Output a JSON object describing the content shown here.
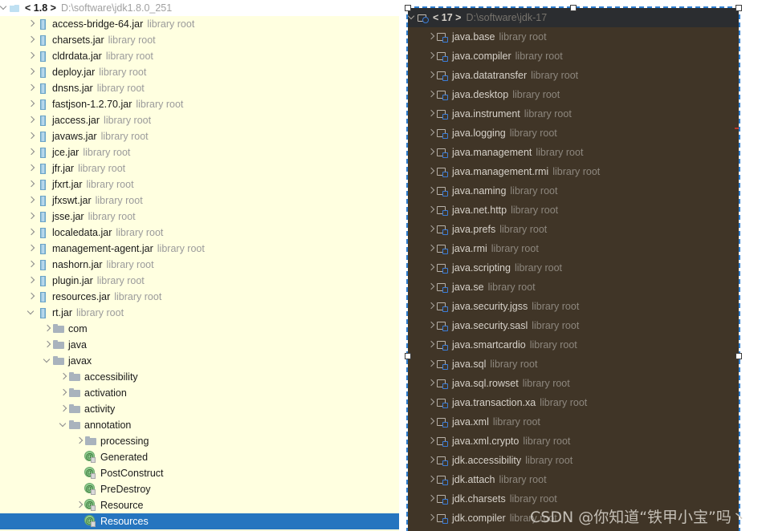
{
  "left_panel": {
    "name": "jdk-1.8-library-tree",
    "background_color": "#ffffe0",
    "selection_color": "#2675bf",
    "root": {
      "version": "1.8",
      "version_display": "< 1.8 >",
      "path": "D:\\software\\jdk1.8.0_251",
      "expanded": true
    },
    "sub_label": "library root",
    "items": [
      {
        "label": "access-bridge-64.jar",
        "sub": "library root",
        "icon": "jar-icon",
        "indent": 1,
        "arrow": "right"
      },
      {
        "label": "charsets.jar",
        "sub": "library root",
        "icon": "jar-icon",
        "indent": 1,
        "arrow": "right"
      },
      {
        "label": "cldrdata.jar",
        "sub": "library root",
        "icon": "jar-icon",
        "indent": 1,
        "arrow": "right"
      },
      {
        "label": "deploy.jar",
        "sub": "library root",
        "icon": "jar-icon",
        "indent": 1,
        "arrow": "right"
      },
      {
        "label": "dnsns.jar",
        "sub": "library root",
        "icon": "jar-icon",
        "indent": 1,
        "arrow": "right"
      },
      {
        "label": "fastjson-1.2.70.jar",
        "sub": "library root",
        "icon": "jar-icon",
        "indent": 1,
        "arrow": "right"
      },
      {
        "label": "jaccess.jar",
        "sub": "library root",
        "icon": "jar-icon",
        "indent": 1,
        "arrow": "right"
      },
      {
        "label": "javaws.jar",
        "sub": "library root",
        "icon": "jar-icon",
        "indent": 1,
        "arrow": "right"
      },
      {
        "label": "jce.jar",
        "sub": "library root",
        "icon": "jar-icon",
        "indent": 1,
        "arrow": "right"
      },
      {
        "label": "jfr.jar",
        "sub": "library root",
        "icon": "jar-icon",
        "indent": 1,
        "arrow": "right"
      },
      {
        "label": "jfxrt.jar",
        "sub": "library root",
        "icon": "jar-icon",
        "indent": 1,
        "arrow": "right"
      },
      {
        "label": "jfxswt.jar",
        "sub": "library root",
        "icon": "jar-icon",
        "indent": 1,
        "arrow": "right"
      },
      {
        "label": "jsse.jar",
        "sub": "library root",
        "icon": "jar-icon",
        "indent": 1,
        "arrow": "right"
      },
      {
        "label": "localedata.jar",
        "sub": "library root",
        "icon": "jar-icon",
        "indent": 1,
        "arrow": "right"
      },
      {
        "label": "management-agent.jar",
        "sub": "library root",
        "icon": "jar-icon",
        "indent": 1,
        "arrow": "right"
      },
      {
        "label": "nashorn.jar",
        "sub": "library root",
        "icon": "jar-icon",
        "indent": 1,
        "arrow": "right"
      },
      {
        "label": "plugin.jar",
        "sub": "library root",
        "icon": "jar-icon",
        "indent": 1,
        "arrow": "right"
      },
      {
        "label": "resources.jar",
        "sub": "library root",
        "icon": "jar-icon",
        "indent": 1,
        "arrow": "right"
      },
      {
        "label": "rt.jar",
        "sub": "library root",
        "icon": "jar-icon",
        "indent": 1,
        "arrow": "down"
      },
      {
        "label": "com",
        "sub": "",
        "icon": "folder-icon",
        "indent": 2,
        "arrow": "right"
      },
      {
        "label": "java",
        "sub": "",
        "icon": "folder-icon",
        "indent": 2,
        "arrow": "right"
      },
      {
        "label": "javax",
        "sub": "",
        "icon": "folder-icon",
        "indent": 2,
        "arrow": "down"
      },
      {
        "label": "accessibility",
        "sub": "",
        "icon": "folder-icon",
        "indent": 3,
        "arrow": "right"
      },
      {
        "label": "activation",
        "sub": "",
        "icon": "folder-icon",
        "indent": 3,
        "arrow": "right"
      },
      {
        "label": "activity",
        "sub": "",
        "icon": "folder-icon",
        "indent": 3,
        "arrow": "right"
      },
      {
        "label": "annotation",
        "sub": "",
        "icon": "folder-icon",
        "indent": 3,
        "arrow": "down"
      },
      {
        "label": "processing",
        "sub": "",
        "icon": "folder-icon",
        "indent": 4,
        "arrow": "right"
      },
      {
        "label": "Generated",
        "sub": "",
        "icon": "annotation-icon",
        "indent": 4,
        "arrow": "none"
      },
      {
        "label": "PostConstruct",
        "sub": "",
        "icon": "annotation-icon",
        "indent": 4,
        "arrow": "none"
      },
      {
        "label": "PreDestroy",
        "sub": "",
        "icon": "annotation-icon",
        "indent": 4,
        "arrow": "none"
      },
      {
        "label": "Resource",
        "sub": "",
        "icon": "annotation-icon",
        "indent": 4,
        "arrow": "right"
      },
      {
        "label": "Resources",
        "sub": "",
        "icon": "annotation-icon",
        "indent": 4,
        "arrow": "none",
        "selected": true
      }
    ]
  },
  "right_panel": {
    "name": "jdk-17-module-tree",
    "background_color": "#403527",
    "header_color": "#2b2d30",
    "selection_border_color": "#2f7fd0",
    "root": {
      "version": "17",
      "version_display": "< 17 >",
      "path": "D:\\software\\jdk-17",
      "expanded": true
    },
    "sub_label": "library root",
    "items": [
      {
        "label": "java.base",
        "sub": "library root",
        "icon": "module-icon",
        "arrow": "right"
      },
      {
        "label": "java.compiler",
        "sub": "library root",
        "icon": "module-icon",
        "arrow": "right"
      },
      {
        "label": "java.datatransfer",
        "sub": "library root",
        "icon": "module-icon",
        "arrow": "right"
      },
      {
        "label": "java.desktop",
        "sub": "library root",
        "icon": "module-icon",
        "arrow": "right"
      },
      {
        "label": "java.instrument",
        "sub": "library root",
        "icon": "module-icon",
        "arrow": "right"
      },
      {
        "label": "java.logging",
        "sub": "library root",
        "icon": "module-icon",
        "arrow": "right"
      },
      {
        "label": "java.management",
        "sub": "library root",
        "icon": "module-icon",
        "arrow": "right"
      },
      {
        "label": "java.management.rmi",
        "sub": "library root",
        "icon": "module-icon",
        "arrow": "right"
      },
      {
        "label": "java.naming",
        "sub": "library root",
        "icon": "module-icon",
        "arrow": "right"
      },
      {
        "label": "java.net.http",
        "sub": "library root",
        "icon": "module-icon",
        "arrow": "right"
      },
      {
        "label": "java.prefs",
        "sub": "library root",
        "icon": "module-icon",
        "arrow": "right"
      },
      {
        "label": "java.rmi",
        "sub": "library root",
        "icon": "module-icon",
        "arrow": "right"
      },
      {
        "label": "java.scripting",
        "sub": "library root",
        "icon": "module-icon",
        "arrow": "right"
      },
      {
        "label": "java.se",
        "sub": "library root",
        "icon": "module-icon",
        "arrow": "right"
      },
      {
        "label": "java.security.jgss",
        "sub": "library root",
        "icon": "module-icon",
        "arrow": "right"
      },
      {
        "label": "java.security.sasl",
        "sub": "library root",
        "icon": "module-icon",
        "arrow": "right"
      },
      {
        "label": "java.smartcardio",
        "sub": "library root",
        "icon": "module-icon",
        "arrow": "right"
      },
      {
        "label": "java.sql",
        "sub": "library root",
        "icon": "module-icon",
        "arrow": "right"
      },
      {
        "label": "java.sql.rowset",
        "sub": "library root",
        "icon": "module-icon",
        "arrow": "right"
      },
      {
        "label": "java.transaction.xa",
        "sub": "library root",
        "icon": "module-icon",
        "arrow": "right"
      },
      {
        "label": "java.xml",
        "sub": "library root",
        "icon": "module-icon",
        "arrow": "right"
      },
      {
        "label": "java.xml.crypto",
        "sub": "library root",
        "icon": "module-icon",
        "arrow": "right"
      },
      {
        "label": "jdk.accessibility",
        "sub": "library root",
        "icon": "module-icon",
        "arrow": "right"
      },
      {
        "label": "jdk.attach",
        "sub": "library root",
        "icon": "module-icon",
        "arrow": "right"
      },
      {
        "label": "jdk.charsets",
        "sub": "library root",
        "icon": "module-icon",
        "arrow": "right"
      },
      {
        "label": "jdk.compiler",
        "sub": "library root",
        "icon": "module-icon",
        "arrow": "right"
      }
    ]
  },
  "watermark": {
    "text": "CSDN @你知道“铁甲小宝”吗丶"
  }
}
